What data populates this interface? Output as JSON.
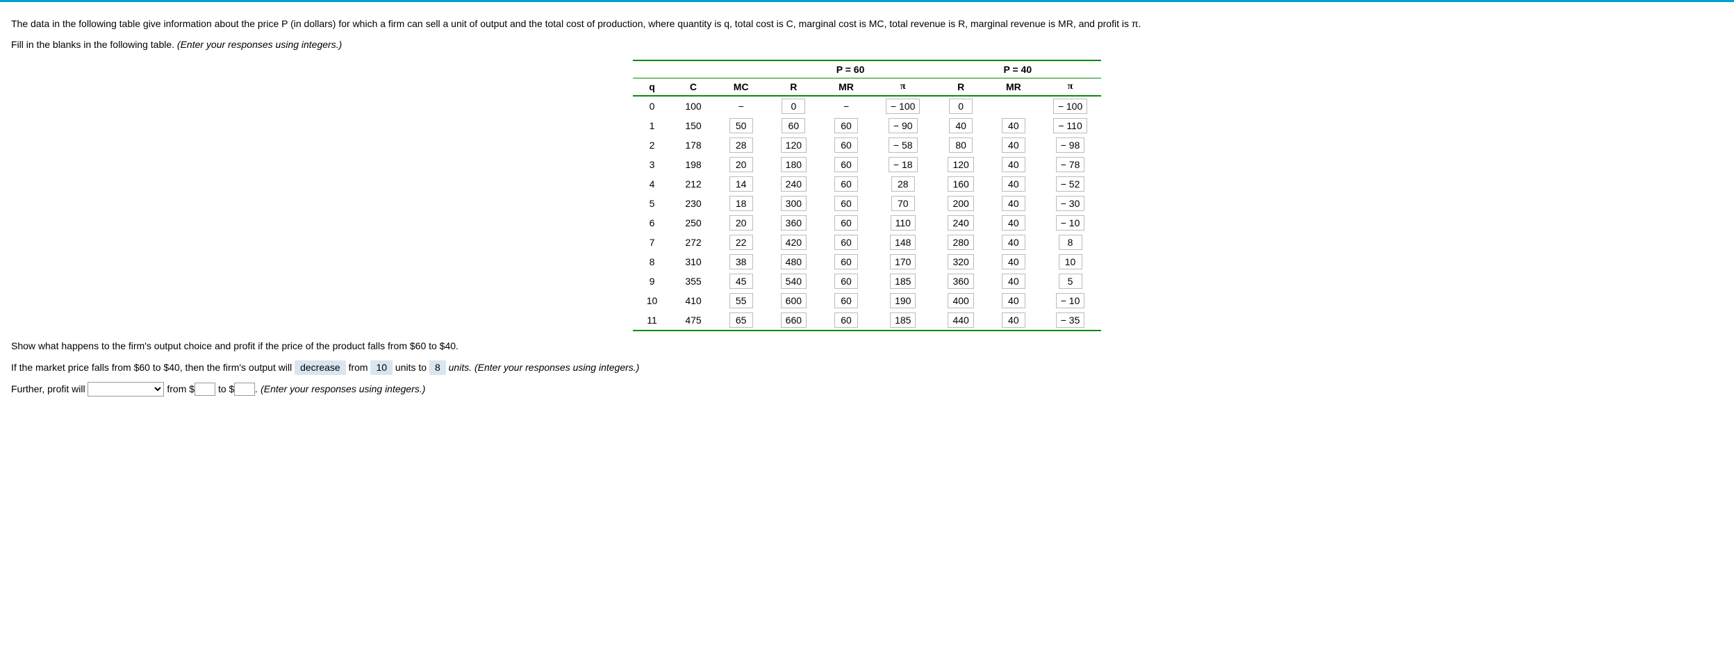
{
  "intro": "The data in the following table give information about the price P (in dollars) for which a firm can sell a unit of output and the total cost of production, where quantity is q, total cost is C, marginal cost is MC, total revenue is R, marginal revenue is MR, and profit is π.",
  "fill_line": "Fill in the blanks in the following table. (Enter your responses using integers.)",
  "headers": {
    "p60": "P = 60",
    "p40": "P = 40",
    "q": "q",
    "c": "C",
    "mc": "MC",
    "r": "R",
    "mr": "MR",
    "pi": "π"
  },
  "rows": [
    {
      "q": "0",
      "c": "100",
      "mc": "−",
      "r60": "0",
      "mr60": "−",
      "pi60": "− 100",
      "r40": "0",
      "mr40": "",
      "pi40": "− 100",
      "box_r60": true,
      "box_r40": true
    },
    {
      "q": "1",
      "c": "150",
      "mc": "50",
      "r60": "60",
      "mr60": "60",
      "pi60": "− 90",
      "r40": "40",
      "mr40": "40",
      "pi40": "− 110"
    },
    {
      "q": "2",
      "c": "178",
      "mc": "28",
      "r60": "120",
      "mr60": "60",
      "pi60": "− 58",
      "r40": "80",
      "mr40": "40",
      "pi40": "− 98"
    },
    {
      "q": "3",
      "c": "198",
      "mc": "20",
      "r60": "180",
      "mr60": "60",
      "pi60": "− 18",
      "r40": "120",
      "mr40": "40",
      "pi40": "− 78"
    },
    {
      "q": "4",
      "c": "212",
      "mc": "14",
      "r60": "240",
      "mr60": "60",
      "pi60": "28",
      "r40": "160",
      "mr40": "40",
      "pi40": "− 52"
    },
    {
      "q": "5",
      "c": "230",
      "mc": "18",
      "r60": "300",
      "mr60": "60",
      "pi60": "70",
      "r40": "200",
      "mr40": "40",
      "pi40": "− 30"
    },
    {
      "q": "6",
      "c": "250",
      "mc": "20",
      "r60": "360",
      "mr60": "60",
      "pi60": "110",
      "r40": "240",
      "mr40": "40",
      "pi40": "− 10"
    },
    {
      "q": "7",
      "c": "272",
      "mc": "22",
      "r60": "420",
      "mr60": "60",
      "pi60": "148",
      "r40": "280",
      "mr40": "40",
      "pi40": "8"
    },
    {
      "q": "8",
      "c": "310",
      "mc": "38",
      "r60": "480",
      "mr60": "60",
      "pi60": "170",
      "r40": "320",
      "mr40": "40",
      "pi40": "10"
    },
    {
      "q": "9",
      "c": "355",
      "mc": "45",
      "r60": "540",
      "mr60": "60",
      "pi60": "185",
      "r40": "360",
      "mr40": "40",
      "pi40": "5"
    },
    {
      "q": "10",
      "c": "410",
      "mc": "55",
      "r60": "600",
      "mr60": "60",
      "pi60": "190",
      "r40": "400",
      "mr40": "40",
      "pi40": "− 10"
    },
    {
      "q": "11",
      "c": "475",
      "mc": "65",
      "r60": "660",
      "mr60": "60",
      "pi60": "185",
      "r40": "440",
      "mr40": "40",
      "pi40": "− 35"
    }
  ],
  "q1": "Show what happens to the firm's output choice and profit if the price of the product falls from $60 to $40.",
  "q2": {
    "pre": "If the market price falls from $60 to $40, then the firm's output will ",
    "dec": "decrease",
    "mid1": " from ",
    "v1": "10",
    "mid2": " units to ",
    "v2": "8",
    "post": " units. (Enter your responses using integers.)"
  },
  "q3": {
    "pre": "Further, profit will ",
    "mid1": " from $",
    "mid2": " to $",
    "post": ". (Enter your responses using integers.)",
    "placeholder": "▼"
  }
}
